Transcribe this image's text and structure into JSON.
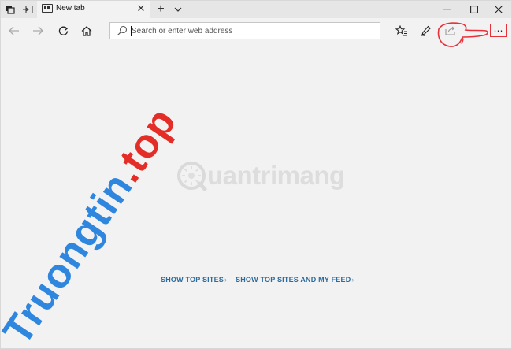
{
  "tab": {
    "title": "New tab"
  },
  "address": {
    "placeholder": "Search or enter web address"
  },
  "links": {
    "show_top_sites": "SHOW TOP SITES",
    "show_top_sites_feed": "SHOW TOP SITES AND MY FEED"
  },
  "watermarks": {
    "quantrimang": "uantrimang",
    "truongtin": "Truongtin.top"
  },
  "colors": {
    "link": "#2b6b9e",
    "highlight": "#e8303a",
    "watermark_red": "#e52d27",
    "watermark_blue": "#2e86de"
  }
}
